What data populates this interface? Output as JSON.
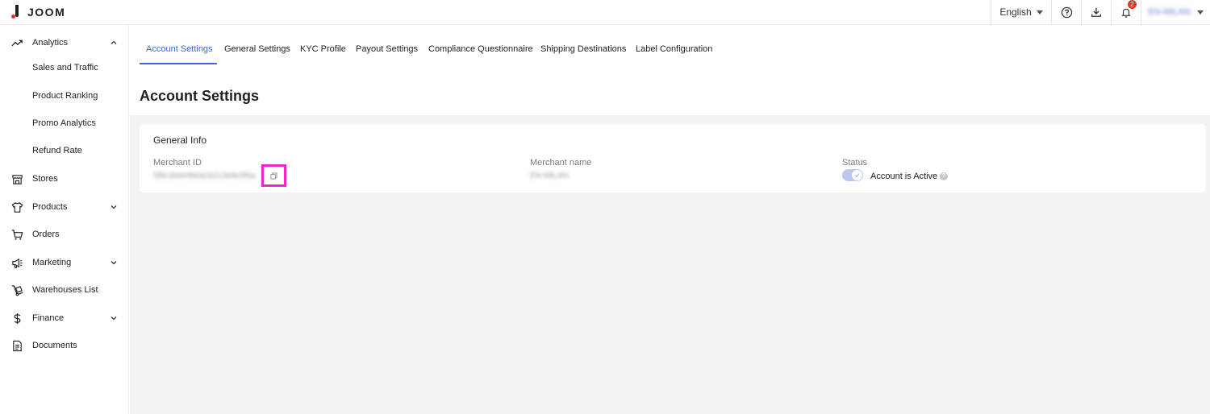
{
  "app": {
    "logo_text": "JOOM",
    "brand_color": "#e2352b",
    "accent_color": "#3a6ad8"
  },
  "topbar": {
    "language": "English",
    "notifications_count": "2",
    "user_name": "EN-MILAN",
    "icons": [
      "help-icon",
      "download-icon",
      "bell-icon"
    ]
  },
  "sidebar": {
    "analytics": {
      "label": "Analytics",
      "expanded": true,
      "children": [
        "Sales and Traffic",
        "Product Ranking",
        "Promo Analytics",
        "Refund Rate"
      ]
    },
    "items": [
      {
        "label": "Stores",
        "icon": "store-icon"
      },
      {
        "label": "Products",
        "icon": "tshirt-icon",
        "expandable": true
      },
      {
        "label": "Orders",
        "icon": "cart-icon"
      },
      {
        "label": "Marketing",
        "icon": "megaphone-icon",
        "expandable": true
      },
      {
        "label": "Warehouses List",
        "icon": "dolly-icon"
      },
      {
        "label": "Finance",
        "icon": "dollar-icon",
        "expandable": true
      },
      {
        "label": "Documents",
        "icon": "document-icon"
      }
    ]
  },
  "tabs": [
    {
      "label": "Account Settings",
      "active": true
    },
    {
      "label": "General Settings"
    },
    {
      "label": "KYC Profile"
    },
    {
      "label": "Payout Settings"
    },
    {
      "label": "Compliance Questionnaire"
    },
    {
      "label": "Shipping Destinations"
    },
    {
      "label": "Label Configuration"
    }
  ],
  "page_title": "Account Settings",
  "general_info": {
    "title": "General Info",
    "merchant_id_label": "Merchant ID",
    "merchant_id_value": "5f8c3d4e9b0a1b2c3d4e5f6a",
    "merchant_name_label": "Merchant name",
    "merchant_name_value": "EN-MILAN",
    "status_label": "Status",
    "status_text": "Account is Active",
    "status_active": true
  }
}
